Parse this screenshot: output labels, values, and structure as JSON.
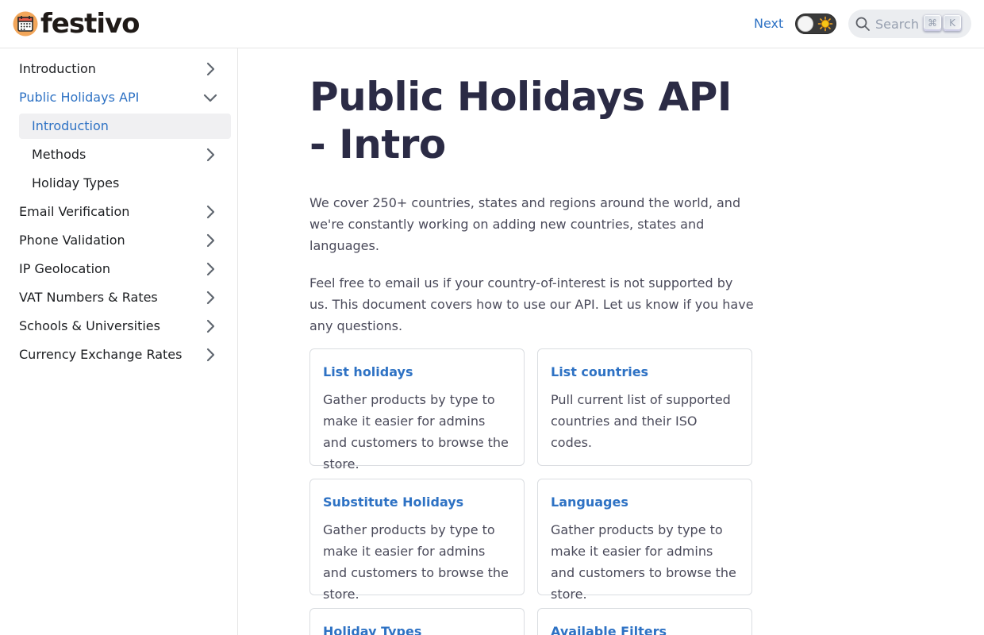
{
  "brand": {
    "name": "festivo"
  },
  "navbar": {
    "next_label": "Next",
    "search_placeholder": "Search",
    "kbd_cmd": "⌘",
    "kbd_k": "K"
  },
  "sidebar": {
    "items": [
      {
        "label": "Introduction"
      },
      {
        "label": "Public Holidays API",
        "expanded": true,
        "children": [
          {
            "label": "Introduction",
            "current": true
          },
          {
            "label": "Methods"
          },
          {
            "label": "Holiday Types"
          }
        ]
      },
      {
        "label": "Email Verification"
      },
      {
        "label": "Phone Validation"
      },
      {
        "label": "IP Geolocation"
      },
      {
        "label": "VAT Numbers & Rates"
      },
      {
        "label": "Schools & Universities"
      },
      {
        "label": "Currency Exchange Rates"
      }
    ]
  },
  "page": {
    "title": "Public Holidays API - Intro",
    "paragraphs": [
      "We cover 250+ countries, states and regions around the world, and we're constantly working on adding new countries, states and languages.",
      "Feel free to email us if your country-of-interest is not supported by us. This document covers how to use our API. Let us know if you have any questions."
    ]
  },
  "cards": [
    {
      "title": "List holidays",
      "desc": "Gather products by type to make it easier for admins and customers to browse the store."
    },
    {
      "title": "List countries",
      "desc": "Pull current list of supported countries and their ISO codes."
    },
    {
      "title": "Substitute Holidays",
      "desc": "Gather products by type to make it easier for admins and customers to browse the store."
    },
    {
      "title": "Languages",
      "desc": "Gather products by type to make it easier for admins and customers to browse the store."
    },
    {
      "title": "Holiday Types",
      "desc": ""
    },
    {
      "title": "Available Filters",
      "desc": ""
    }
  ],
  "colors": {
    "accent": "#2e72c4",
    "title": "#2b2b45",
    "text": "#4a4a5a",
    "border": "#dadde1"
  }
}
